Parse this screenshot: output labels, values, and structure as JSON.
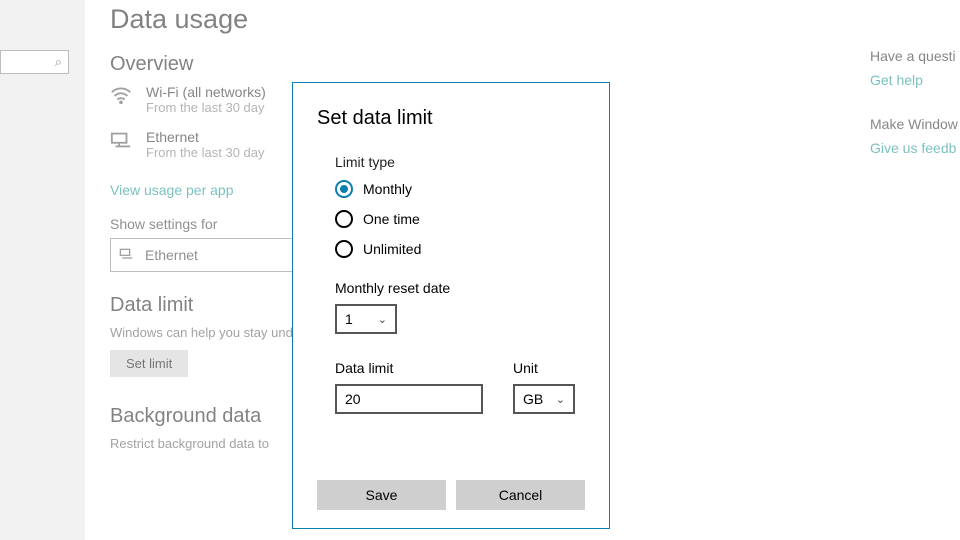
{
  "page": {
    "title": "Data usage",
    "overview_heading": "Overview",
    "wifi": {
      "title": "Wi-Fi (all networks)",
      "sub": "From the last 30 day"
    },
    "ethernet": {
      "title": "Ethernet",
      "sub": "From the last 30 day"
    },
    "view_usage_link": "View usage per app",
    "show_settings_label": "Show settings for",
    "show_settings_value": "Ethernet",
    "data_limit_heading": "Data limit",
    "data_limit_desc": "Windows can help you stay under your limit. This won't change your data plan.",
    "set_limit_btn": "Set limit",
    "bg_heading": "Background data",
    "bg_desc": "Restrict background data to"
  },
  "right": {
    "question": "Have a questi",
    "get_help": "Get help",
    "make_better": "Make Window",
    "feedback": "Give us feedb"
  },
  "modal": {
    "title": "Set data limit",
    "limit_type_label": "Limit type",
    "options": {
      "monthly": "Monthly",
      "onetime": "One time",
      "unlimited": "Unlimited"
    },
    "selected": "monthly",
    "reset_label": "Monthly reset date",
    "reset_value": "1",
    "data_limit_label": "Data limit",
    "data_limit_value": "20",
    "unit_label": "Unit",
    "unit_value": "GB",
    "save": "Save",
    "cancel": "Cancel"
  }
}
